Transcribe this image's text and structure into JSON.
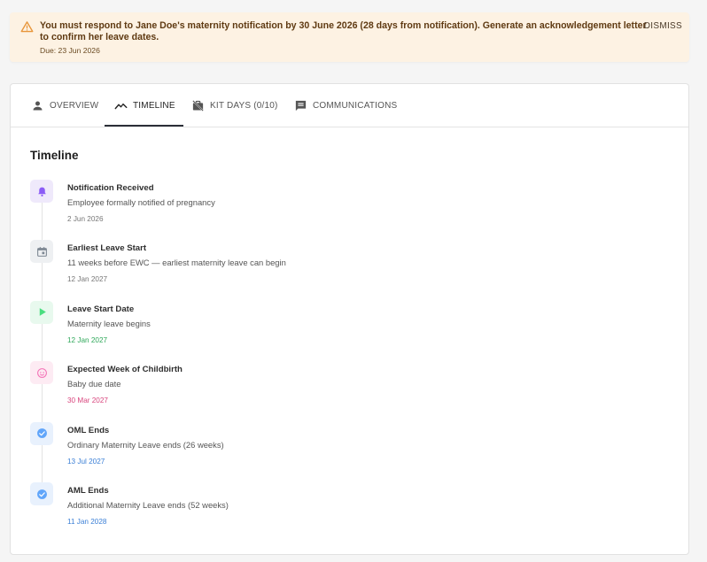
{
  "alert": {
    "message": "You must respond to Jane Doe's maternity notification by 30 June 2026 (28 days from notification). Generate an acknowledgement letter to confirm her leave dates.",
    "due": "Due: 23 Jun 2026",
    "dismiss_label": "DISMISS",
    "icon": "warning-triangle-icon",
    "color": "#fdf2e3"
  },
  "tabs": [
    {
      "label": "OVERVIEW",
      "icon": "person-icon",
      "active": false
    },
    {
      "label": "TIMELINE",
      "icon": "trending-icon",
      "active": true
    },
    {
      "label": "KIT DAYS (0/10)",
      "icon": "work-off-icon",
      "active": false
    },
    {
      "label": "COMMUNICATIONS",
      "icon": "chat-icon",
      "active": false
    }
  ],
  "timeline": {
    "title": "Timeline",
    "events": [
      {
        "title": "Notification Received",
        "description": "Employee formally notified of pregnancy",
        "date": "2 Jun 2026",
        "icon": "bell-icon",
        "icon_color": "#8b5cf6",
        "icon_bg": "#efe9fb",
        "date_color": "#777777"
      },
      {
        "title": "Earliest Leave Start",
        "description": "11 weeks before EWC — earliest maternity leave can begin",
        "date": "12 Jan 2027",
        "icon": "calendar-event-icon",
        "icon_color": "#7d8793",
        "icon_bg": "#eef0f2",
        "date_color": "#777777"
      },
      {
        "title": "Leave Start Date",
        "description": "Maternity leave begins",
        "date": "12 Jan 2027",
        "icon": "play-icon",
        "icon_color": "#4ade80",
        "icon_bg": "#e8f9ee",
        "date_color": "#2fa85a"
      },
      {
        "title": "Expected Week of Childbirth",
        "description": "Baby due date",
        "date": "30 Mar 2027",
        "icon": "baby-face-icon",
        "icon_color": "#f472b6",
        "icon_bg": "#fdebf3",
        "date_color": "#d9467e"
      },
      {
        "title": "OML Ends",
        "description": "Ordinary Maternity Leave ends (26 weeks)",
        "date": "13 Jul 2027",
        "icon": "check-circle-icon",
        "icon_color": "#60a5fa",
        "icon_bg": "#e8f1fd",
        "date_color": "#3b7fd6"
      },
      {
        "title": "AML Ends",
        "description": "Additional Maternity Leave ends (52 weeks)",
        "date": "11 Jan 2028",
        "icon": "check-circle-icon",
        "icon_color": "#60a5fa",
        "icon_bg": "#e8f1fd",
        "date_color": "#3b7fd6"
      }
    ]
  }
}
